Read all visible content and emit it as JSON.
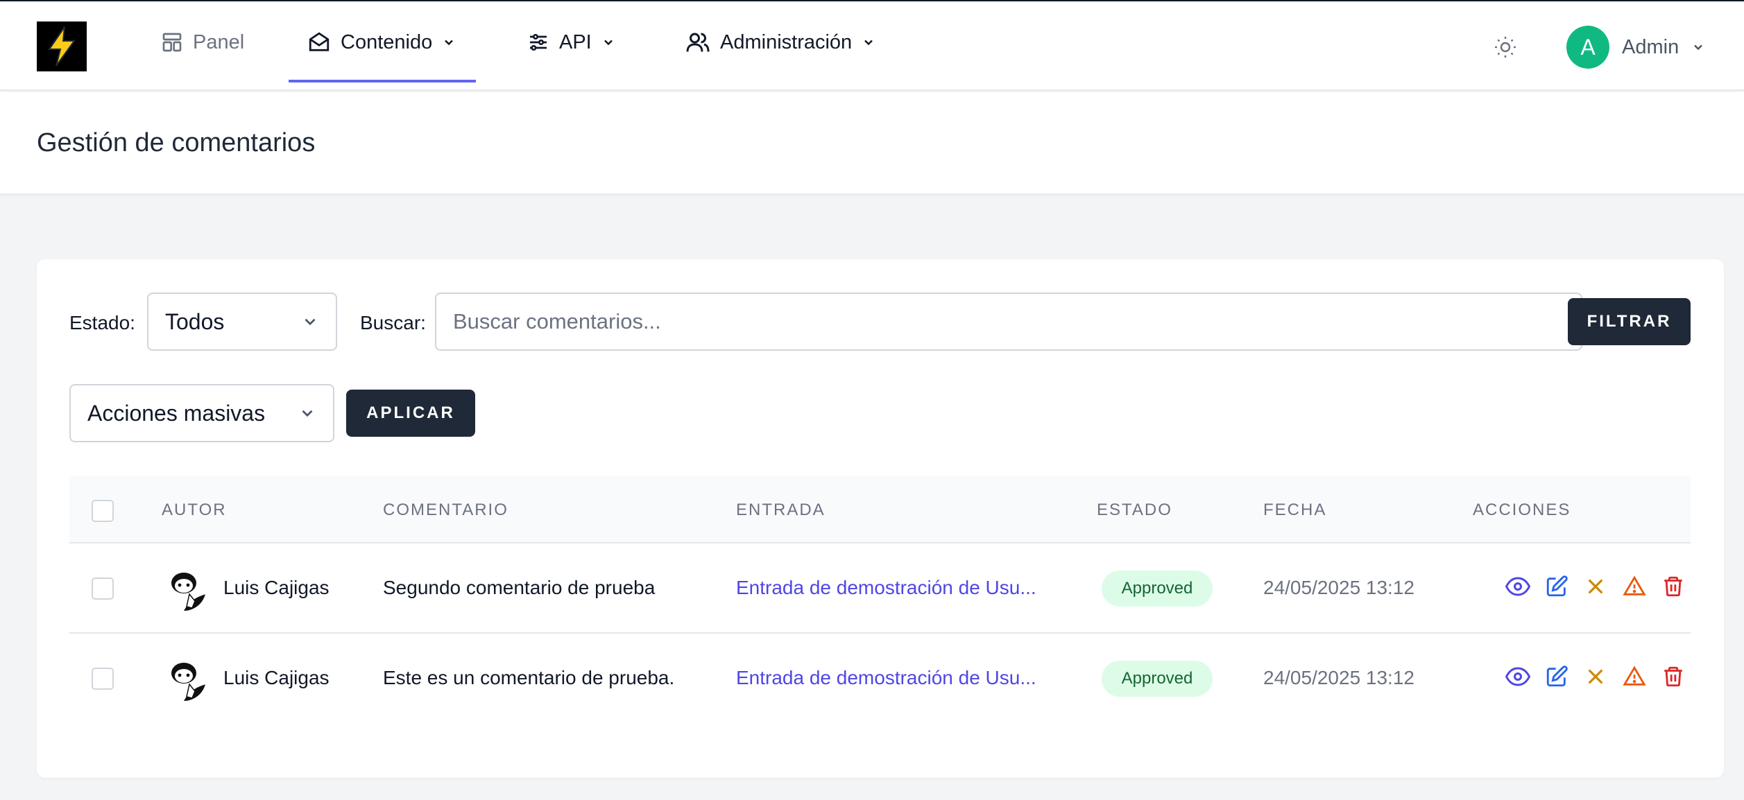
{
  "nav": {
    "items": [
      {
        "label": "Panel",
        "icon": "layout-icon"
      },
      {
        "label": "Contenido",
        "icon": "mail-open-icon"
      },
      {
        "label": "API",
        "icon": "sliders-icon"
      },
      {
        "label": "Administración",
        "icon": "users-icon"
      }
    ],
    "user_initial": "A",
    "user_name": "Admin"
  },
  "page": {
    "title": "Gestión de comentarios"
  },
  "filters": {
    "status_label": "Estado:",
    "status_value": "Todos",
    "search_label": "Buscar:",
    "search_placeholder": "Buscar comentarios...",
    "filter_button": "FILTRAR",
    "bulk_value": "Acciones masivas",
    "apply_button": "APLICAR"
  },
  "table": {
    "headers": [
      "AUTOR",
      "COMENTARIO",
      "ENTRADA",
      "ESTADO",
      "FECHA",
      "ACCIONES"
    ],
    "rows": [
      {
        "author": "Luis Cajigas",
        "comment": "Segundo comentario de prueba",
        "entry": "Entrada de demostración de Usu...",
        "status": "Approved",
        "date": "24/05/2025 13:12"
      },
      {
        "author": "Luis Cajigas",
        "comment": "Este es un comentario de prueba.",
        "entry": "Entrada de demostración de Usu...",
        "status": "Approved",
        "date": "24/05/2025 13:12"
      }
    ]
  },
  "colors": {
    "accent": "#6366f1",
    "dark_button": "#1f2937",
    "approved_bg": "#dcfce7",
    "approved_text": "#166534",
    "link": "#4f46e5",
    "avatar": "#10b981",
    "logo_bolt": "#facc15"
  }
}
